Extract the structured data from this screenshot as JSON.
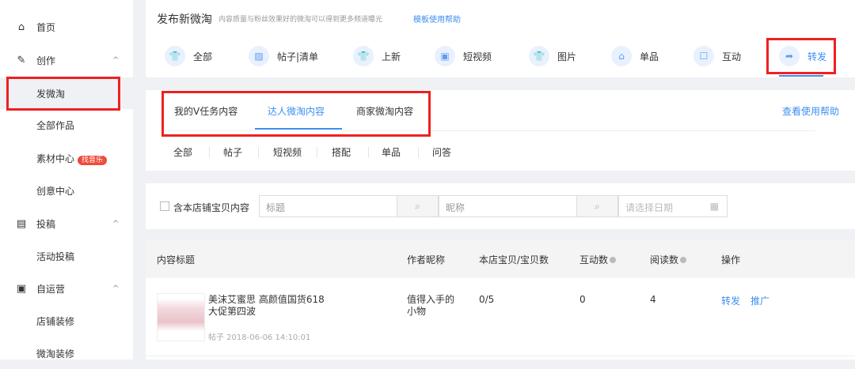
{
  "sidebar": {
    "items": [
      {
        "label": "首页",
        "icon": "home-icon"
      },
      {
        "label": "创作",
        "icon": "pen-icon",
        "chevron": "^"
      },
      {
        "label": "发微淘"
      },
      {
        "label": "全部作品"
      },
      {
        "label": "素材中心",
        "badge": "找音乐"
      },
      {
        "label": "创意中心"
      },
      {
        "label": "投稿",
        "icon": "document-icon",
        "chevron": "^"
      },
      {
        "label": "活动投稿"
      },
      {
        "label": "自运营",
        "icon": "box-icon",
        "chevron": "^"
      },
      {
        "label": "店铺装修"
      },
      {
        "label": "微淘装修"
      }
    ]
  },
  "header": {
    "title": "发布新微淘",
    "subtitle": "内容质量与粉丝效果好的微淘可以得到更多频道曝光",
    "help": "模板使用帮助"
  },
  "tabs": [
    {
      "label": "全部"
    },
    {
      "label": "帖子|清单"
    },
    {
      "label": "上新"
    },
    {
      "label": "短视频"
    },
    {
      "label": "图片"
    },
    {
      "label": "单品"
    },
    {
      "label": "互动"
    },
    {
      "label": "转发"
    }
  ],
  "subtabs": {
    "items": [
      "我的V任务内容",
      "达人微淘内容",
      "商家微淘内容"
    ],
    "help": "查看使用帮助"
  },
  "categories": [
    "全部",
    "帖子",
    "短视频",
    "搭配",
    "单品",
    "问答"
  ],
  "filter": {
    "checkbox": "含本店铺宝贝内容",
    "title_placeholder": "标题",
    "nick_placeholder": "昵称",
    "date_placeholder": "请选择日期"
  },
  "table": {
    "headers": [
      "内容标题",
      "作者昵称",
      "本店宝贝/宝贝数",
      "互动数",
      "阅读数",
      "操作"
    ],
    "rows": [
      {
        "title": "美沫艾蜜思 高颜值国货618 大促第四波",
        "meta": "帖子 2018-06-06 14:10:01",
        "author": "值得入手的小物",
        "items": "0/5",
        "interactions": "0",
        "reads": "4",
        "actions": [
          "转发",
          "推广"
        ]
      }
    ]
  },
  "colors": {
    "accent": "#3c8ef0",
    "highlight": "#ef2020"
  }
}
